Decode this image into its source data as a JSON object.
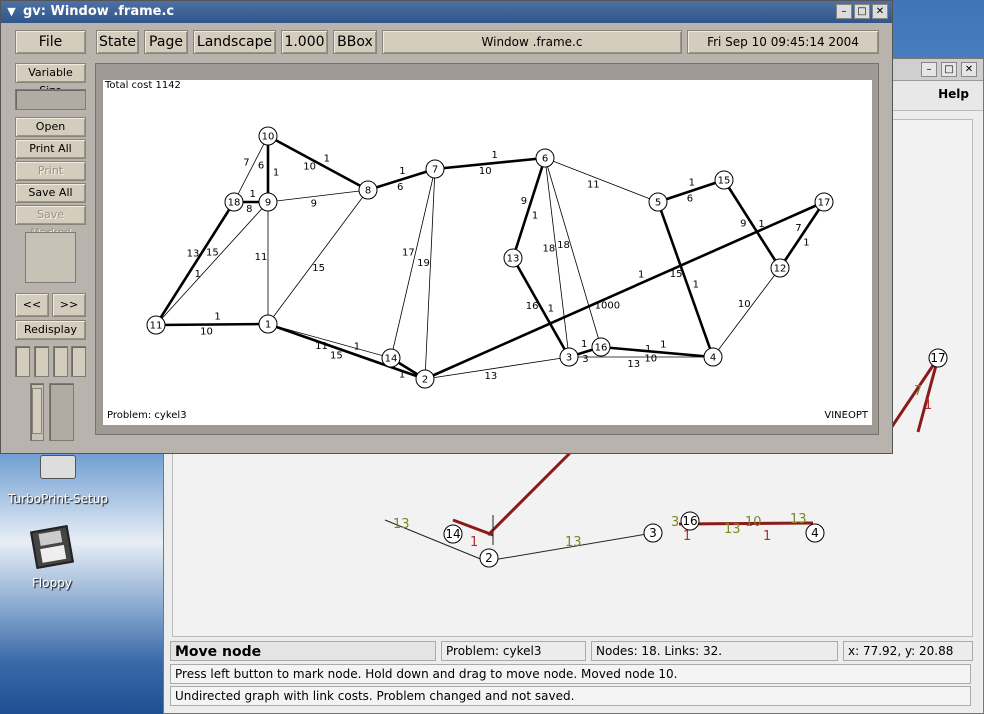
{
  "desktop": {
    "icons": [
      {
        "label": "TurboPrint-Setup"
      },
      {
        "label": "Floppy"
      }
    ]
  },
  "back_window": {
    "help_label": "Help",
    "status": {
      "mode": "Move node",
      "problem": "Problem: cykel3",
      "counts": "Nodes: 18. Links: 32.",
      "coords": "x: 77.92, y: 20.88"
    },
    "message1": "Press left button to mark node. Hold down and drag to move node. Moved node 10.",
    "message2": "Undirected graph with link costs. Problem changed and not saved.",
    "preview_nodes": [
      {
        "id": "17"
      },
      {
        "id": "14"
      },
      {
        "id": "2"
      },
      {
        "id": "3"
      },
      {
        "id": "16"
      },
      {
        "id": "4"
      }
    ],
    "preview_labels": [
      "7",
      "1",
      "13",
      "13",
      "1",
      "3",
      "1",
      "13",
      "10",
      "1",
      "13"
    ]
  },
  "gv_window": {
    "title": "gv: Window .frame.c",
    "toolbar": {
      "file": "File",
      "state": "State",
      "page": "Page",
      "orientation": "Landscape",
      "scale": "1.000",
      "bbox": "BBox",
      "filename": "Window .frame.c",
      "date": "Fri Sep 10 09:45:14 2004"
    },
    "side": {
      "variable_size": "Variable Size",
      "open": "Open",
      "print_all": "Print All",
      "print_marked": "Print Marked",
      "save_all": "Save All",
      "save_marked": "Save Marked",
      "prev": "<<",
      "next": ">>",
      "redisplay": "Redisplay"
    },
    "canvas": {
      "total_cost": "Total cost 1142",
      "problem": "Problem: cykel3",
      "brand": "VINEOPT"
    }
  },
  "graph": {
    "nodes": [
      {
        "id": "1"
      },
      {
        "id": "2"
      },
      {
        "id": "3"
      },
      {
        "id": "4"
      },
      {
        "id": "5"
      },
      {
        "id": "6"
      },
      {
        "id": "7"
      },
      {
        "id": "8"
      },
      {
        "id": "9"
      },
      {
        "id": "10"
      },
      {
        "id": "11"
      },
      {
        "id": "12"
      },
      {
        "id": "13"
      },
      {
        "id": "14"
      },
      {
        "id": "15"
      },
      {
        "id": "16"
      },
      {
        "id": "17"
      },
      {
        "id": "18"
      }
    ],
    "edges": [
      {
        "a": "10",
        "b": "9",
        "cost": "6",
        "flow": "1",
        "bold": true
      },
      {
        "a": "10",
        "b": "8",
        "cost": "10",
        "flow": "1",
        "bold": true
      },
      {
        "a": "10",
        "b": "18",
        "cost": "7",
        "flow": "",
        "bold": false
      },
      {
        "a": "18",
        "b": "9",
        "cost": "8",
        "flow": "1",
        "bold": true
      },
      {
        "a": "9",
        "b": "8",
        "cost": "9",
        "flow": "",
        "bold": false
      },
      {
        "a": "9",
        "b": "1",
        "cost": "11",
        "flow": "",
        "bold": false
      },
      {
        "a": "9",
        "b": "11",
        "cost": "15",
        "flow": "",
        "bold": false
      },
      {
        "a": "18",
        "b": "11",
        "cost": "13",
        "flow": "1",
        "bold": true
      },
      {
        "a": "11",
        "b": "1",
        "cost": "10",
        "flow": "1",
        "bold": true
      },
      {
        "a": "1",
        "b": "8",
        "cost": "15",
        "flow": "",
        "bold": false
      },
      {
        "a": "1",
        "b": "14",
        "cost": "11",
        "flow": "",
        "bold": false
      },
      {
        "a": "1",
        "b": "2",
        "cost": "15",
        "flow": "1",
        "bold": true
      },
      {
        "a": "8",
        "b": "7",
        "cost": "6",
        "flow": "1",
        "bold": true
      },
      {
        "a": "7",
        "b": "14",
        "cost": "17",
        "flow": "",
        "bold": false
      },
      {
        "a": "7",
        "b": "2",
        "cost": "19",
        "flow": "",
        "bold": false
      },
      {
        "a": "7",
        "b": "6",
        "cost": "10",
        "flow": "1",
        "bold": true
      },
      {
        "a": "6",
        "b": "13",
        "cost": "9",
        "flow": "1",
        "bold": true
      },
      {
        "a": "6",
        "b": "3",
        "cost": "18",
        "flow": "",
        "bold": false
      },
      {
        "a": "6",
        "b": "16",
        "cost": "18",
        "flow": "",
        "bold": false
      },
      {
        "a": "6",
        "b": "5",
        "cost": "11",
        "flow": "",
        "bold": false
      },
      {
        "a": "13",
        "b": "3",
        "cost": "16",
        "flow": "1",
        "bold": true
      },
      {
        "a": "2",
        "b": "3",
        "cost": "13",
        "flow": "",
        "bold": false
      },
      {
        "a": "2",
        "b": "17",
        "cost": "1000",
        "flow": "1",
        "bold": true
      },
      {
        "a": "3",
        "b": "16",
        "cost": "3",
        "flow": "1",
        "bold": true
      },
      {
        "a": "3",
        "b": "4",
        "cost": "13",
        "flow": "1",
        "bold": false
      },
      {
        "a": "16",
        "b": "4",
        "cost": "10",
        "flow": "1",
        "bold": true
      },
      {
        "a": "5",
        "b": "15",
        "cost": "6",
        "flow": "1",
        "bold": true
      },
      {
        "a": "5",
        "b": "4",
        "cost": "15",
        "flow": "1",
        "bold": true
      },
      {
        "a": "15",
        "b": "12",
        "cost": "9",
        "flow": "1",
        "bold": true
      },
      {
        "a": "17",
        "b": "12",
        "cost": "7",
        "flow": "1",
        "bold": true
      },
      {
        "a": "12",
        "b": "4",
        "cost": "10",
        "flow": "",
        "bold": false
      },
      {
        "a": "2",
        "b": "14",
        "cost": "",
        "flow": "1",
        "bold": true
      }
    ]
  }
}
